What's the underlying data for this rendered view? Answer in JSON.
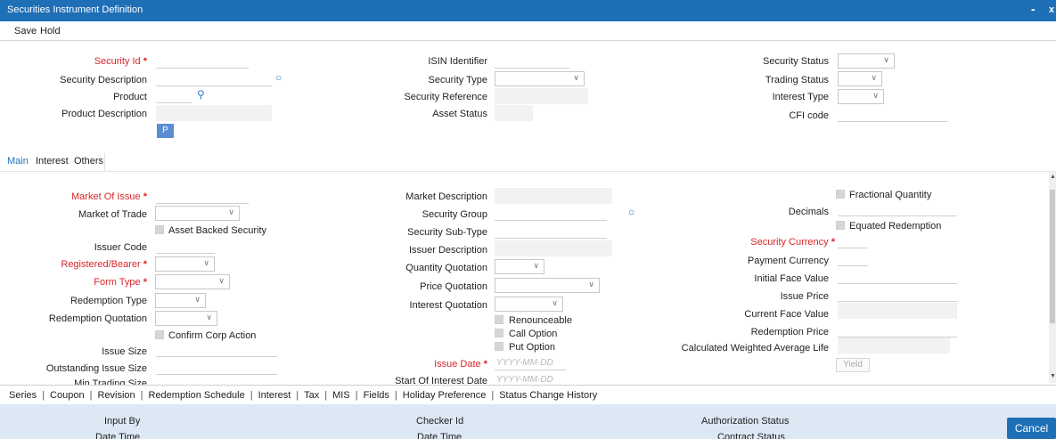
{
  "window": {
    "title": "Securities Instrument Definition",
    "minimize": "-",
    "close": "x"
  },
  "toolbar": {
    "save": "Save",
    "hold": "Hold"
  },
  "header": {
    "security_id": "Security Id",
    "security_description": "Security Description",
    "product": "Product",
    "product_description": "Product Description",
    "p_button": "P",
    "isin_identifier": "ISIN Identifier",
    "security_type": "Security Type",
    "security_reference": "Security Reference",
    "asset_status": "Asset Status",
    "security_status": "Security Status",
    "trading_status": "Trading Status",
    "interest_type": "Interest Type",
    "cfi_code": "CFI code"
  },
  "tabs": [
    "Main",
    "Interest",
    "Others"
  ],
  "main": {
    "market_of_issue": "Market Of Issue",
    "market_of_trade": "Market of Trade",
    "asset_backed_security": "Asset Backed Security",
    "issuer_code": "Issuer Code",
    "registered_bearer": "Registered/Bearer",
    "form_type": "Form Type",
    "redemption_type": "Redemption Type",
    "redemption_quotation": "Redemption Quotation",
    "confirm_corp_action": "Confirm Corp Action",
    "issue_size": "Issue Size",
    "outstanding_issue_size": "Outstanding Issue Size",
    "min_trading_size": "Min Trading Size",
    "market_description": "Market Description",
    "security_group": "Security Group",
    "security_sub_type": "Security Sub-Type",
    "issuer_description": "Issuer Description",
    "quantity_quotation": "Quantity Quotation",
    "price_quotation": "Price Quotation",
    "interest_quotation": "Interest Quotation",
    "renounceable": "Renounceable",
    "call_option": "Call Option",
    "put_option": "Put Option",
    "issue_date": "Issue Date",
    "start_of_interest_date": "Start Of Interest Date",
    "date_placeholder": "YYYY-MM-DD",
    "fractional_quantity": "Fractional Quantity",
    "decimals": "Decimals",
    "equated_redemption": "Equated Redemption",
    "security_currency": "Security Currency",
    "payment_currency": "Payment Currency",
    "initial_face_value": "Initial Face Value",
    "issue_price": "Issue Price",
    "current_face_value": "Current Face Value",
    "redemption_price": "Redemption Price",
    "calc_weighted_avg_life": "Calculated Weighted Average Life",
    "yield_button": "Yield"
  },
  "bottom_links": [
    "Series",
    "Coupon",
    "Revision",
    "Redemption Schedule",
    "Interest",
    "Tax",
    "MIS",
    "Fields",
    "Holiday Preference",
    "Status Change History"
  ],
  "footer": {
    "input_by": "Input By",
    "date_time_1": "Date Time",
    "checker_id": "Checker Id",
    "date_time_2": "Date Time",
    "authorization_status": "Authorization Status",
    "contract_status": "Contract Status",
    "cancel": "Cancel"
  },
  "colors": {
    "title_bar": "#1f6fb7",
    "required_label": "#d9262a",
    "footer_bg": "#dce8f4"
  }
}
